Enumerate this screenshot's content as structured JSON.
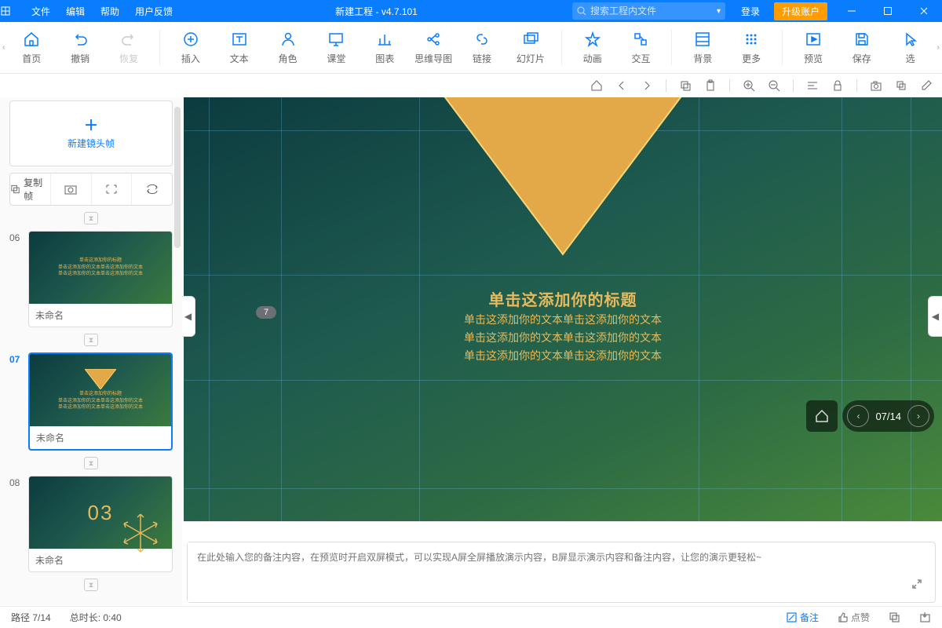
{
  "title_bar": {
    "menus": [
      "文件",
      "编辑",
      "帮助",
      "用户反馈"
    ],
    "title": "新建工程 - v4.7.101",
    "search_placeholder": "搜索工程内文件",
    "login": "登录",
    "upgrade": "升级账户"
  },
  "ribbon": {
    "left_arrow": "‹",
    "right_arrow": "›",
    "groups": {
      "home": "首页",
      "undo": "撤销",
      "redo": "恢复",
      "insert": "插入",
      "text": "文本",
      "role": "角色",
      "class": "课堂",
      "chart": "图表",
      "mindmap": "思维导图",
      "link": "链接",
      "slide": "幻灯片",
      "anim": "动画",
      "interact": "交互",
      "bg": "背景",
      "more": "更多",
      "preview": "预览",
      "save": "保存",
      "select": "选"
    }
  },
  "sidebar": {
    "new_frame": "新建镜头帧",
    "copy_frame": "复制帧",
    "thumbs": [
      {
        "num": "06",
        "name": "未命名"
      },
      {
        "num": "07",
        "name": "未命名"
      },
      {
        "num": "08",
        "name": "未命名",
        "content03": "03"
      }
    ],
    "thumb_text_title": "单击这添加你的标题",
    "thumb_text_body": "单击这添加你的文本单击这添加你的文本"
  },
  "slide": {
    "frame_badge": "7",
    "title": "单击这添加你的标题",
    "body_lines": [
      "单击这添加你的文本单击这添加你的文本",
      "单击这添加你的文本单击这添加你的文本",
      "单击这添加你的文本单击这添加你的文本"
    ],
    "pager": "07/14"
  },
  "notes": {
    "placeholder": "在此处输入您的备注内容，在预览时开启双屏模式，可以实现A屏全屏播放演示内容，B屏显示演示内容和备注内容，让您的演示更轻松~"
  },
  "status": {
    "path": "路径 7/14",
    "duration": "总时长: 0:40",
    "remark": "备注",
    "like": "点赞"
  }
}
